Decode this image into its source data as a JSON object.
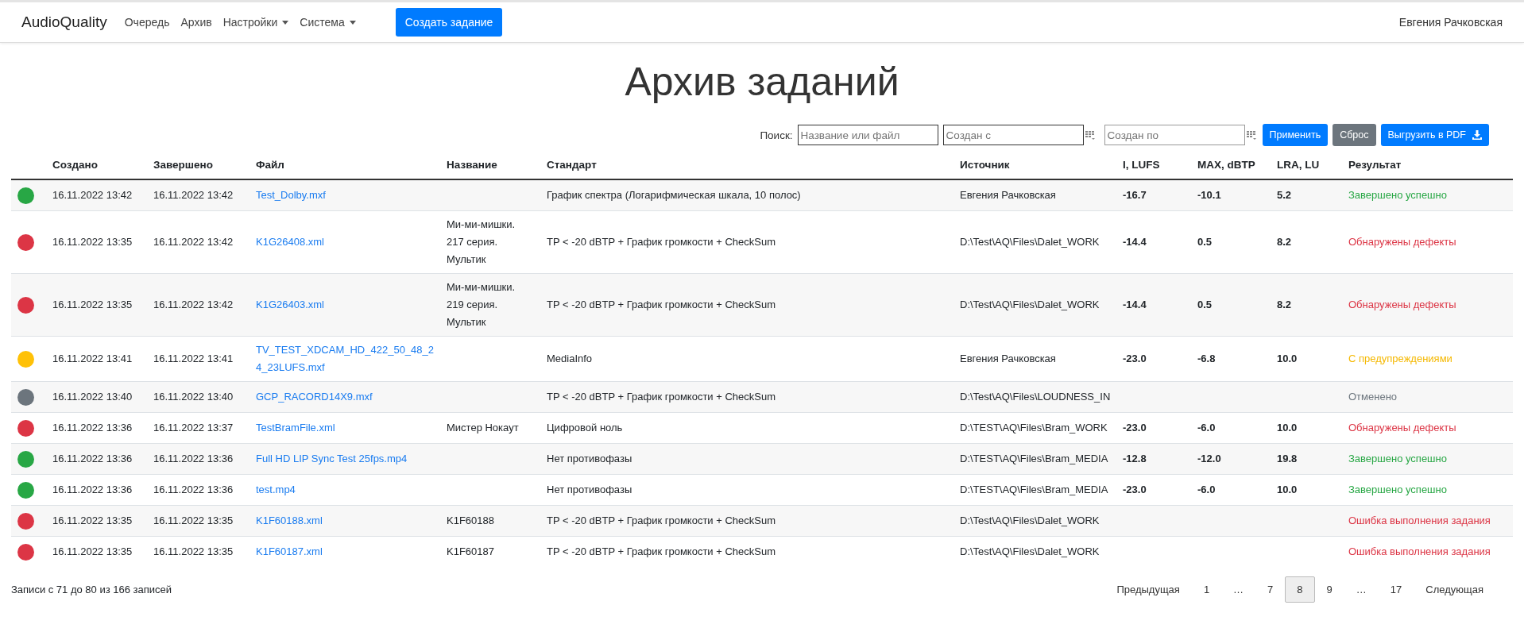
{
  "navbar": {
    "brand": "AudioQuality",
    "links": [
      {
        "label": "Очередь",
        "dropdown": false
      },
      {
        "label": "Архив",
        "dropdown": false
      },
      {
        "label": "Настройки",
        "dropdown": true
      },
      {
        "label": "Система",
        "dropdown": true
      }
    ],
    "create_button": "Создать задание",
    "user": "Евгения Рачковская"
  },
  "title": "Архив заданий",
  "search": {
    "label": "Поиск:",
    "query_placeholder": "Название или файл",
    "from_placeholder": "Создан с",
    "to_placeholder": "Создан по",
    "apply": "Применить",
    "reset": "Сброс",
    "export": "Выгрузить в PDF"
  },
  "table": {
    "columns": [
      "Создано",
      "Завершено",
      "Файл",
      "Название",
      "Стандарт",
      "Источник",
      "I, LUFS",
      "MAX, dBTP",
      "LRA, LU",
      "Результат"
    ],
    "rows": [
      {
        "kind": "success",
        "color": "#28a745",
        "created": "16.11.2022 13:42",
        "completed": "16.11.2022 13:42",
        "file": "Test_Dolby.mxf",
        "name": "",
        "standard": "График спектра (Логарифмическая шкала, 10 полос)",
        "source": "Евгения Рачковская",
        "i_lufs": "-16.7",
        "max_dbtp": "-10.1",
        "lra_lu": "5.2",
        "result": "Завершено успешно"
      },
      {
        "kind": "error",
        "color": "#dc3545",
        "created": "16.11.2022 13:35",
        "completed": "16.11.2022 13:42",
        "file": "K1G26408.xml",
        "name": "Ми-ми-мишки. 217 серия. Мультик",
        "standard": "TP < -20 dBTP + График громкости + CheckSum",
        "source": "D:\\Test\\AQ\\Files\\Dalet_WORK",
        "i_lufs": "-14.4",
        "max_dbtp": "0.5",
        "lra_lu": "8.2",
        "result": "Обнаружены дефекты"
      },
      {
        "kind": "error",
        "color": "#dc3545",
        "created": "16.11.2022 13:35",
        "completed": "16.11.2022 13:42",
        "file": "K1G26403.xml",
        "name": "Ми-ми-мишки. 219 серия. Мультик",
        "standard": "TP < -20 dBTP + График громкости + CheckSum",
        "source": "D:\\Test\\AQ\\Files\\Dalet_WORK",
        "i_lufs": "-14.4",
        "max_dbtp": "0.5",
        "lra_lu": "8.2",
        "result": "Обнаружены дефекты"
      },
      {
        "kind": "warning",
        "color": "#ffc107",
        "created": "16.11.2022 13:41",
        "completed": "16.11.2022 13:41",
        "file": "TV_TEST_XDCAM_HD_422_50_48_24_23LUFS.mxf",
        "name": "",
        "standard": "MediaInfo",
        "source": "Евгения Рачковская",
        "i_lufs": "-23.0",
        "max_dbtp": "-6.8",
        "lra_lu": "10.0",
        "result": "С предупреждениями"
      },
      {
        "kind": "cancelled",
        "color": "#6c757d",
        "created": "16.11.2022 13:40",
        "completed": "16.11.2022 13:40",
        "file": "GCP_RACORD14X9.mxf",
        "name": "",
        "standard": "TP < -20 dBTP + График громкости + CheckSum",
        "source": "D:\\Test\\AQ\\Files\\LOUDNESS_IN",
        "i_lufs": "",
        "max_dbtp": "",
        "lra_lu": "",
        "result": "Отменено"
      },
      {
        "kind": "error",
        "color": "#dc3545",
        "created": "16.11.2022 13:36",
        "completed": "16.11.2022 13:37",
        "file": "TestBramFile.xml",
        "name": "Мистер Нокаут",
        "standard": "Цифровой ноль",
        "source": "D:\\TEST\\AQ\\Files\\Bram_WORK",
        "i_lufs": "-23.0",
        "max_dbtp": "-6.0",
        "lra_lu": "10.0",
        "result": "Обнаружены дефекты"
      },
      {
        "kind": "success",
        "color": "#28a745",
        "created": "16.11.2022 13:36",
        "completed": "16.11.2022 13:36",
        "file": "Full HD LIP Sync Test 25fps.mp4",
        "name": "",
        "standard": "Нет противофазы",
        "source": "D:\\TEST\\AQ\\Files\\Bram_MEDIA",
        "i_lufs": "-12.8",
        "max_dbtp": "-12.0",
        "lra_lu": "19.8",
        "result": "Завершено успешно"
      },
      {
        "kind": "success",
        "color": "#28a745",
        "created": "16.11.2022 13:36",
        "completed": "16.11.2022 13:36",
        "file": "test.mp4",
        "name": "",
        "standard": "Нет противофазы",
        "source": "D:\\TEST\\AQ\\Files\\Bram_MEDIA",
        "i_lufs": "-23.0",
        "max_dbtp": "-6.0",
        "lra_lu": "10.0",
        "result": "Завершено успешно"
      },
      {
        "kind": "error",
        "color": "#dc3545",
        "created": "16.11.2022 13:35",
        "completed": "16.11.2022 13:35",
        "file": "K1F60188.xml",
        "name": "K1F60188",
        "standard": "TP < -20 dBTP + График громкости + CheckSum",
        "source": "D:\\Test\\AQ\\Files\\Dalet_WORK",
        "i_lufs": "",
        "max_dbtp": "",
        "lra_lu": "",
        "result": "Ошибка выполнения задания"
      },
      {
        "kind": "error",
        "color": "#dc3545",
        "created": "16.11.2022 13:35",
        "completed": "16.11.2022 13:35",
        "file": "K1F60187.xml",
        "name": "K1F60187",
        "standard": "TP < -20 dBTP + График громкости + CheckSum",
        "source": "D:\\Test\\AQ\\Files\\Dalet_WORK",
        "i_lufs": "",
        "max_dbtp": "",
        "lra_lu": "",
        "result": "Ошибка выполнения задания"
      }
    ]
  },
  "footer": {
    "summary": "Записи с 71 до 80 из 166 записей",
    "pagination": [
      {
        "label": "Предыдущая",
        "selected": false
      },
      {
        "label": "1",
        "selected": false
      },
      {
        "label": "…",
        "selected": false
      },
      {
        "label": "7",
        "selected": false
      },
      {
        "label": "8",
        "selected": true
      },
      {
        "label": "9",
        "selected": false
      },
      {
        "label": "…",
        "selected": false
      },
      {
        "label": "17",
        "selected": false
      },
      {
        "label": "Следующая",
        "selected": false
      }
    ]
  }
}
